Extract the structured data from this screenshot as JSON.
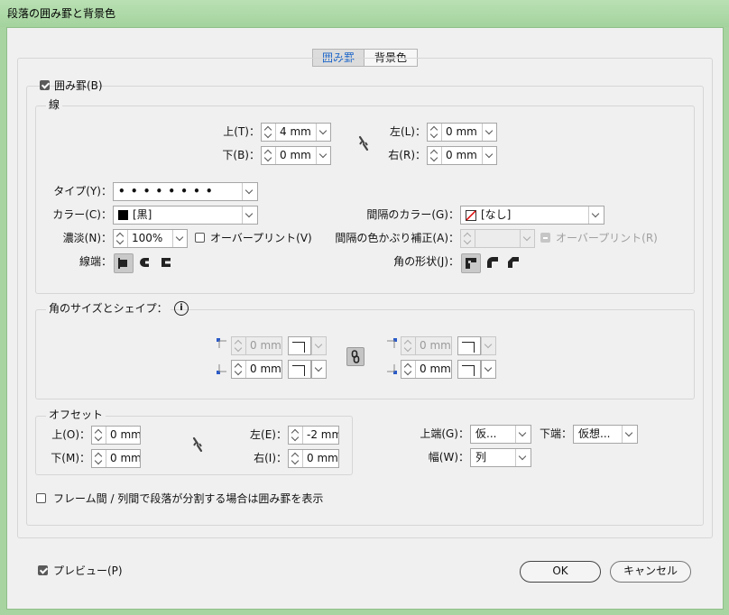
{
  "window": {
    "title": "段落の囲み罫と背景色"
  },
  "tabs": [
    {
      "label": "囲み罫",
      "active": true
    },
    {
      "label": "背景色",
      "active": false
    }
  ],
  "border": {
    "enable_label": "囲み罫(B)",
    "enabled": true,
    "stroke": {
      "legend": "線",
      "top_label": "上(T)：",
      "top_value": "4 mm",
      "bottom_label": "下(B)：",
      "bottom_value": "0 mm",
      "left_label": "左(L)：",
      "left_value": "0 mm",
      "right_label": "右(R)：",
      "right_value": "0 mm",
      "type_label": "タイプ(Y)：",
      "type_value": "• • • • • • • •",
      "color_label": "カラー(C)：",
      "color_value": "[黒]",
      "tint_label": "濃淡(N)：",
      "tint_value": "100%",
      "overprint_label": "オーバープリント(V)",
      "cap_label": "線端：",
      "gap_color_label": "間隔のカラー(G)：",
      "gap_color_value": "[なし]",
      "gap_tint_label": "間隔の色かぶり補正(A)：",
      "gap_tint_value": "",
      "gap_overprint_label": "オーバープリント(R)",
      "join_label": "角の形状(J)："
    },
    "corner": {
      "legend": "角のサイズとシェイプ：",
      "tl_value": "0 mm",
      "bl_value": "0 mm",
      "tr_value": "0 mm",
      "br_value": "0 mm"
    },
    "offset": {
      "legend": "オフセット",
      "top_label": "上(O)：",
      "top_value": "0 mm",
      "bottom_label": "下(M)：",
      "bottom_value": "0 mm",
      "left_label": "左(E)：",
      "left_value": "-2 mm",
      "right_label": "右(I)：",
      "right_value": "0 mm"
    },
    "top_edge_label": "上端(G)：",
    "top_edge_value": "仮...",
    "bottom_edge_label": "下端：",
    "bottom_edge_value": "仮想...",
    "width_label": "幅(W)：",
    "width_value": "列",
    "split_label": "フレーム間 / 列間で段落が分割する場合は囲み罫を表示"
  },
  "footer": {
    "preview_label": "プレビュー(P)",
    "ok_label": "OK",
    "cancel_label": "キャンセル"
  },
  "colors": {
    "accent": "#1a64c8",
    "titlebar": "#a7d4a0"
  }
}
